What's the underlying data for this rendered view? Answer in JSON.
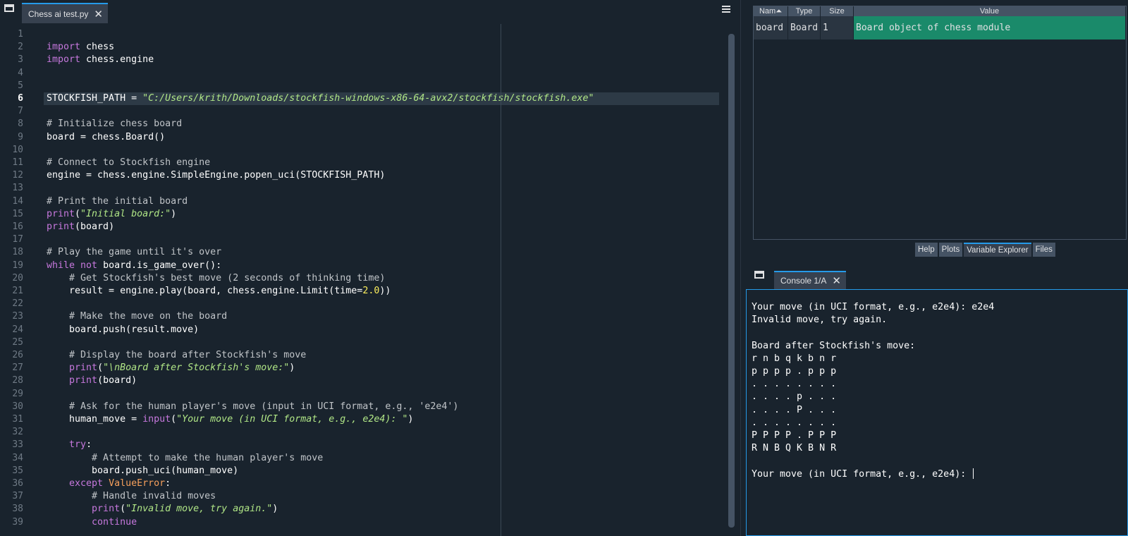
{
  "editor": {
    "tab_label": "Chess ai test.py",
    "current_line": 6,
    "lines": [
      [],
      [
        [
          "kw",
          "import"
        ],
        [
          "t",
          " chess"
        ]
      ],
      [
        [
          "kw",
          "import"
        ],
        [
          "t",
          " chess.engine"
        ]
      ],
      [],
      [],
      [
        [
          "t",
          "STOCKFISH_PATH = "
        ],
        [
          "str",
          "\"C:/Users/krith/Downloads/stockfish-windows-x86-64-avx2/stockfish/stockfish.exe\""
        ]
      ],
      [],
      [
        [
          "com",
          "# Initialize chess board"
        ]
      ],
      [
        [
          "t",
          "board = chess.Board()"
        ]
      ],
      [],
      [
        [
          "com",
          "# Connect to Stockfish engine"
        ]
      ],
      [
        [
          "t",
          "engine = chess.engine.SimpleEngine.popen_uci(STOCKFISH_PATH)"
        ]
      ],
      [],
      [
        [
          "com",
          "# Print the initial board"
        ]
      ],
      [
        [
          "fn",
          "print"
        ],
        [
          "t",
          "("
        ],
        [
          "str",
          "\"Initial board:\""
        ],
        [
          "t",
          ")"
        ]
      ],
      [
        [
          "fn",
          "print"
        ],
        [
          "t",
          "(board)"
        ]
      ],
      [],
      [
        [
          "com",
          "# Play the game until it's over"
        ]
      ],
      [
        [
          "kw",
          "while"
        ],
        [
          "t",
          " "
        ],
        [
          "kw",
          "not"
        ],
        [
          "t",
          " board.is_game_over():"
        ]
      ],
      [
        [
          "t",
          "    "
        ],
        [
          "com",
          "# Get Stockfish's best move (2 seconds of thinking time)"
        ]
      ],
      [
        [
          "t",
          "    result = engine.play(board, chess.engine.Limit(time="
        ],
        [
          "num",
          "2.0"
        ],
        [
          "t",
          "))"
        ]
      ],
      [],
      [
        [
          "t",
          "    "
        ],
        [
          "com",
          "# Make the move on the board"
        ]
      ],
      [
        [
          "t",
          "    board.push(result.move)"
        ]
      ],
      [],
      [
        [
          "t",
          "    "
        ],
        [
          "com",
          "# Display the board after Stockfish's move"
        ]
      ],
      [
        [
          "t",
          "    "
        ],
        [
          "fn",
          "print"
        ],
        [
          "t",
          "("
        ],
        [
          "str",
          "\"\\nBoard after Stockfish's move:\""
        ],
        [
          "t",
          ")"
        ]
      ],
      [
        [
          "t",
          "    "
        ],
        [
          "fn",
          "print"
        ],
        [
          "t",
          "(board)"
        ]
      ],
      [],
      [
        [
          "t",
          "    "
        ],
        [
          "com",
          "# Ask for the human player's move (input in UCI format, e.g., 'e2e4')"
        ]
      ],
      [
        [
          "t",
          "    human_move = "
        ],
        [
          "fn",
          "input"
        ],
        [
          "t",
          "("
        ],
        [
          "str",
          "\"Your move (in UCI format, e.g., e2e4): \""
        ],
        [
          "t",
          ")"
        ]
      ],
      [],
      [
        [
          "t",
          "    "
        ],
        [
          "kw",
          "try"
        ],
        [
          "t",
          ":"
        ]
      ],
      [
        [
          "t",
          "        "
        ],
        [
          "com",
          "# Attempt to make the human player's move"
        ]
      ],
      [
        [
          "t",
          "        board.push_uci(human_move)"
        ]
      ],
      [
        [
          "t",
          "    "
        ],
        [
          "kw",
          "except"
        ],
        [
          "t",
          " "
        ],
        [
          "cls",
          "ValueError"
        ],
        [
          "t",
          ":"
        ]
      ],
      [
        [
          "t",
          "        "
        ],
        [
          "com",
          "# Handle invalid moves"
        ]
      ],
      [
        [
          "t",
          "        "
        ],
        [
          "fn",
          "print"
        ],
        [
          "t",
          "("
        ],
        [
          "str",
          "\"Invalid move, try again.\""
        ],
        [
          "t",
          ")"
        ]
      ],
      [
        [
          "t",
          "        "
        ],
        [
          "kw",
          "continue"
        ]
      ]
    ]
  },
  "variable_explorer": {
    "headers": [
      "Nam⏶",
      "Type",
      "Size",
      "Value"
    ],
    "rows": [
      {
        "name": "board",
        "type": "Board",
        "size": "1",
        "value": "Board object of chess module"
      }
    ]
  },
  "pane_tabs": [
    "Help",
    "Plots",
    "Variable Explorer",
    "Files"
  ],
  "active_pane_tab": "Variable Explorer",
  "console": {
    "tab_label": "Console 1/A",
    "lines": [
      "Your move (in UCI format, e.g., e2e4): e2e4",
      "Invalid move, try again.",
      "",
      "Board after Stockfish's move:",
      "r n b q k b n r",
      "p p p p . p p p",
      ". . . . . . . .",
      ". . . . p . . .",
      ". . . . P . . .",
      ". . . . . . . .",
      "P P P P . P P P",
      "R N B Q K B N R",
      "",
      "Your move (in UCI format, e.g., e2e4): "
    ]
  },
  "colors": {
    "accent": "#259ae9",
    "selected_row": "#1a8a6a",
    "keyword": "#c678dd",
    "string": "#b0e686"
  }
}
